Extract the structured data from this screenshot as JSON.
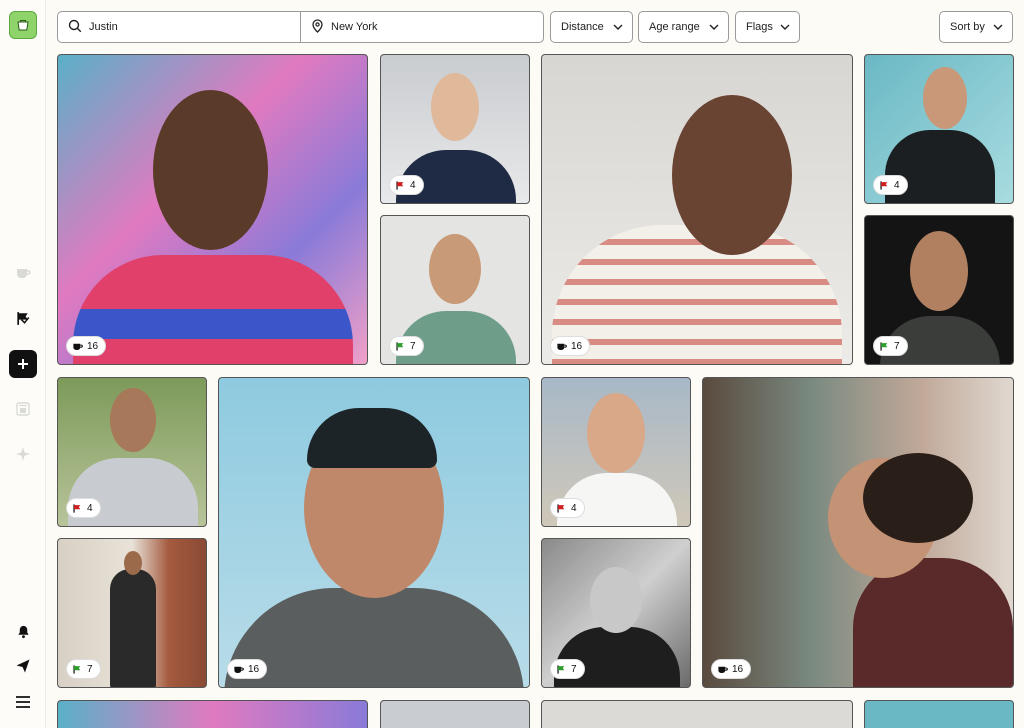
{
  "search": {
    "name_value": "Justin",
    "location_value": "New York"
  },
  "filters": {
    "distance": "Distance",
    "age_range": "Age range",
    "flags": "Flags",
    "sort_by": "Sort by"
  },
  "sidebar": {
    "items": [
      {
        "name": "cup-icon"
      },
      {
        "name": "flag-icon"
      },
      {
        "name": "add-icon"
      },
      {
        "name": "coffee-machine-icon"
      },
      {
        "name": "sparkle-icon"
      },
      {
        "name": "bell-icon"
      },
      {
        "name": "send-icon"
      },
      {
        "name": "menu-icon"
      }
    ]
  },
  "cards": [
    {
      "badge_icon": "cup-icon",
      "count": "16"
    },
    {
      "badge_icon": "flag-icon",
      "flag_color": "#d11f1f",
      "count": "4"
    },
    {
      "badge_icon": "flag-icon",
      "flag_color": "#2f9e2f",
      "count": "7"
    },
    {
      "badge_icon": "cup-icon",
      "count": "16"
    },
    {
      "badge_icon": "flag-icon",
      "flag_color": "#d11f1f",
      "count": "4"
    },
    {
      "badge_icon": "flag-icon",
      "flag_color": "#2f9e2f",
      "count": "7"
    },
    {
      "badge_icon": "flag-icon",
      "flag_color": "#d11f1f",
      "count": "4"
    },
    {
      "badge_icon": "flag-icon",
      "flag_color": "#2f9e2f",
      "count": "7"
    },
    {
      "badge_icon": "cup-icon",
      "count": "16"
    },
    {
      "badge_icon": "flag-icon",
      "flag_color": "#d11f1f",
      "count": "4"
    },
    {
      "badge_icon": "flag-icon",
      "flag_color": "#2f9e2f",
      "count": "7"
    },
    {
      "badge_icon": "cup-icon",
      "count": "16"
    }
  ],
  "colors": {
    "brand": "#8fd46a",
    "flag_red": "#d11f1f",
    "flag_green": "#2f9e2f"
  }
}
